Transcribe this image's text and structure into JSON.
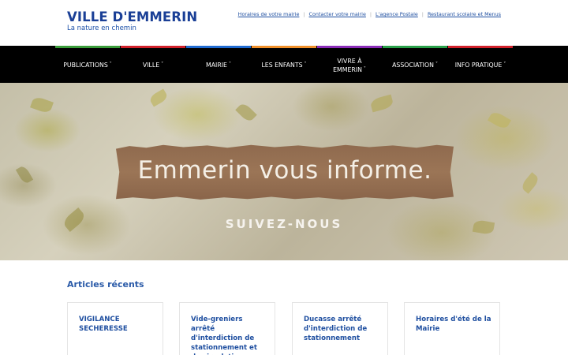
{
  "header": {
    "site_title": "VILLE D'EMMERIN",
    "tagline": "La nature en chemin",
    "top_links": [
      "Horaires de votre mairie",
      "Contacter votre mairie",
      "L'agence Postale",
      "Restaurant scolaire et Menus"
    ]
  },
  "nav": {
    "items": [
      {
        "label_line1": "PUBLICATIONS",
        "label_line2": "",
        "color": "#3a9c3a"
      },
      {
        "label_line1": "VILLE",
        "label_line2": "",
        "color": "#d0202a"
      },
      {
        "label_line1": "MAIRIE",
        "label_line2": "",
        "color": "#1f6ad0"
      },
      {
        "label_line1": "LES ENFANTS",
        "label_line2": "",
        "color": "#f0902a"
      },
      {
        "label_line1": "VIVRE À",
        "label_line2": "EMMERIN",
        "color": "#8a2cb8"
      },
      {
        "label_line1": "ASSOCIATION",
        "label_line2": "",
        "color": "#2aa04a"
      },
      {
        "label_line1": "INFO PRATIQUE",
        "label_line2": "",
        "color": "#d0202a"
      }
    ],
    "caret": "˅"
  },
  "hero": {
    "headline": "Emmerin vous informe.",
    "subtitle": "SUIVEZ-NOUS"
  },
  "articles": {
    "title": "Articles récents",
    "cards": [
      {
        "title": "VIGILANCE SECHERESSE"
      },
      {
        "title": "Vide-greniers arrêté d'interdiction de stationnement et de circulation"
      },
      {
        "title": "Ducasse arrêté d'interdiction de stationnement"
      },
      {
        "title": "Horaires d'été de la Mairie"
      }
    ]
  }
}
